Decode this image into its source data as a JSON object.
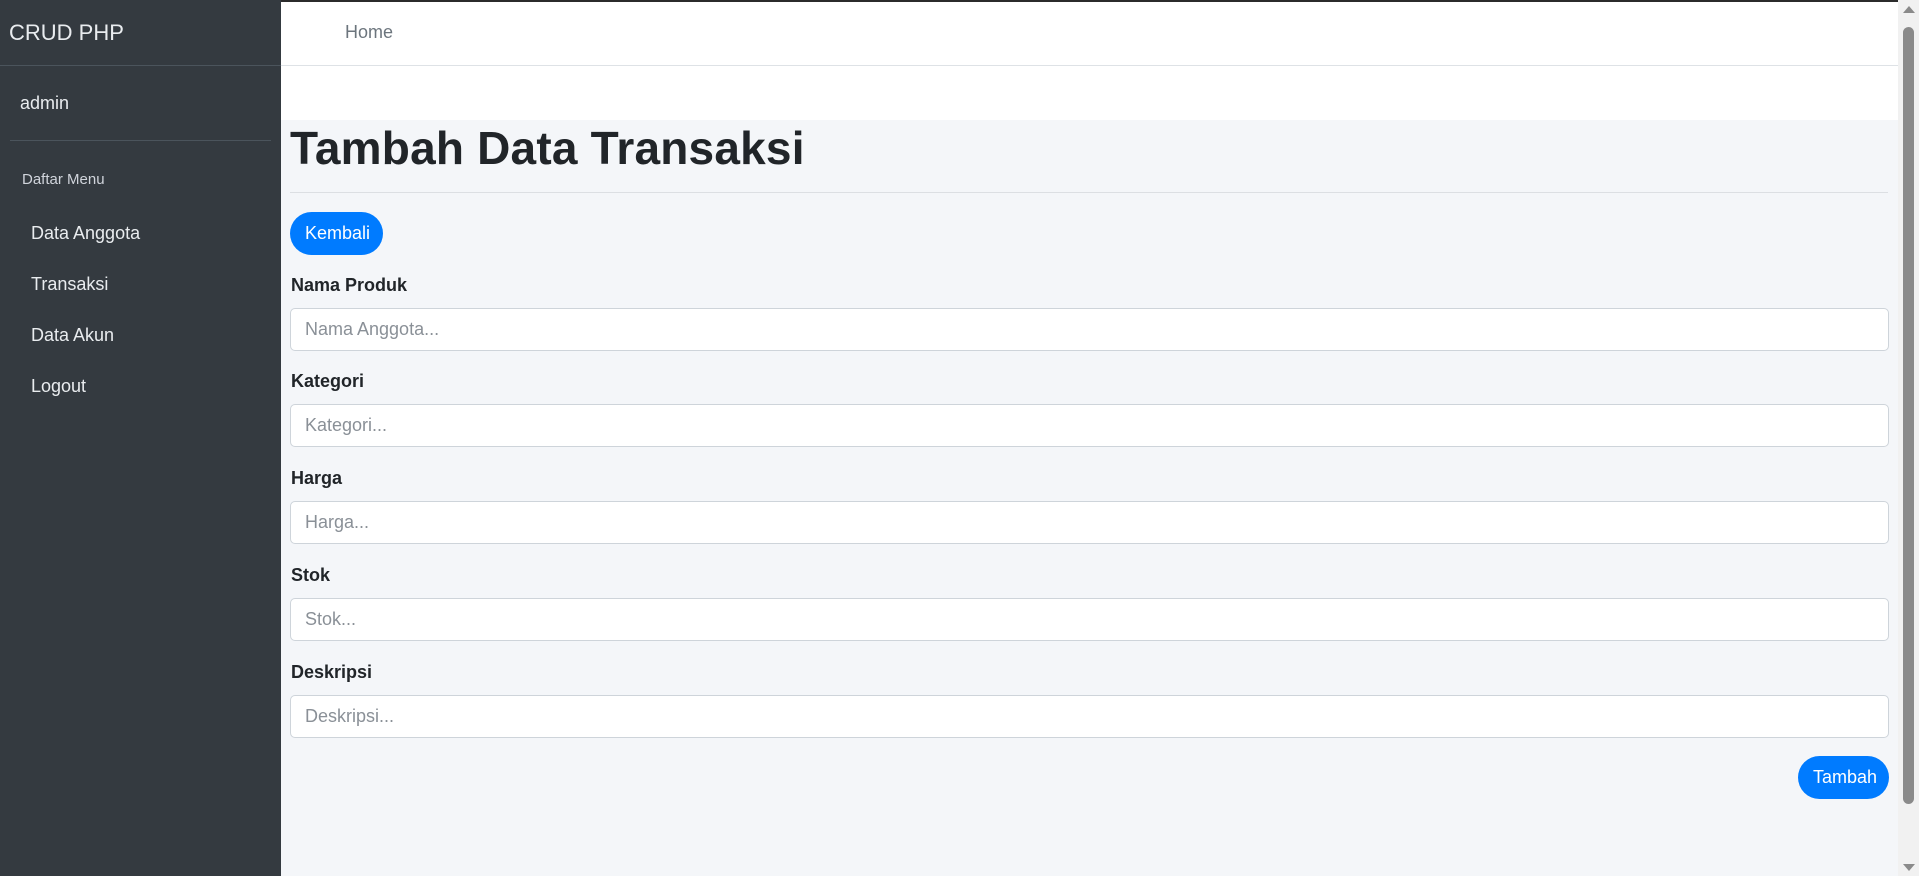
{
  "sidebar": {
    "brand": "CRUD PHP",
    "user": "admin",
    "menu_header": "Daftar Menu",
    "items": [
      {
        "label": "Data Anggota"
      },
      {
        "label": "Transaksi"
      },
      {
        "label": "Data Akun"
      },
      {
        "label": "Logout"
      }
    ]
  },
  "topnav": {
    "home_label": "Home"
  },
  "main": {
    "title": "Tambah Data Transaksi",
    "back_label": "Kembali",
    "submit_label": "Tambah",
    "fields": [
      {
        "label": "Nama Produk",
        "placeholder": "Nama Anggota...",
        "value": ""
      },
      {
        "label": "Kategori",
        "placeholder": "Kategori...",
        "value": ""
      },
      {
        "label": "Harga",
        "placeholder": "Harga...",
        "value": ""
      },
      {
        "label": "Stok",
        "placeholder": "Stok...",
        "value": ""
      },
      {
        "label": "Deskripsi",
        "placeholder": "Deskripsi...",
        "value": ""
      }
    ]
  },
  "colors": {
    "sidebar_bg": "#343a40",
    "content_bg": "#f4f6f9",
    "primary": "#007bff"
  }
}
